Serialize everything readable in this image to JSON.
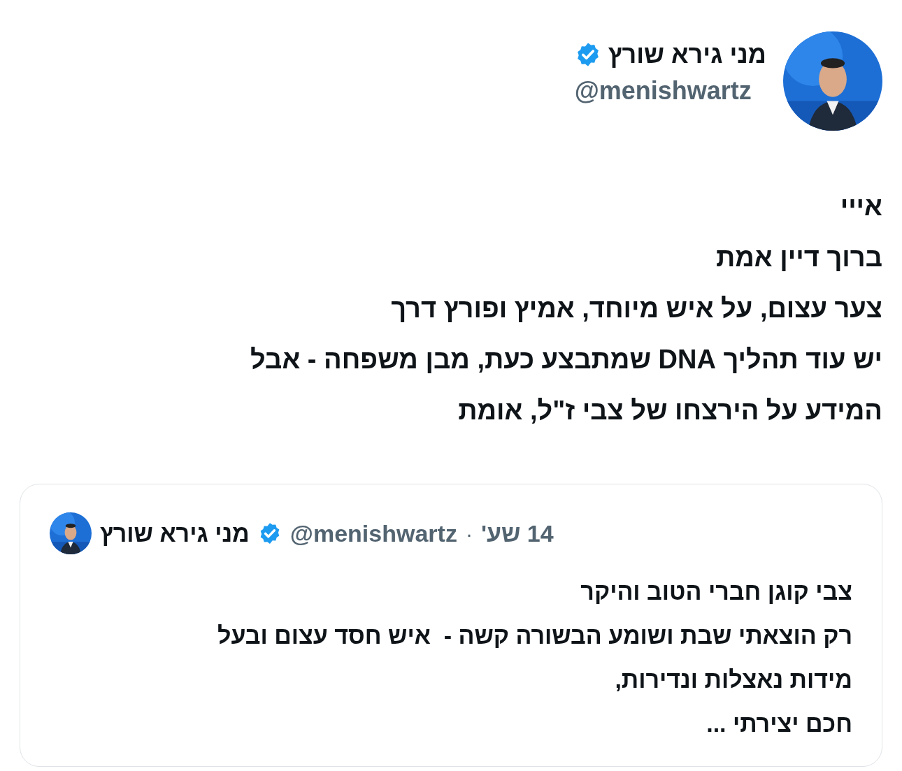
{
  "author": {
    "name": "מני גירא שורץ",
    "handle": "@menishwartz",
    "verified": true
  },
  "text_lines": [
    "אייי",
    "ברוך דיין אמת",
    "צער עצום, על איש מיוחד, אמיץ ופורץ דרך",
    "יש עוד תהליך DNA שמתבצע כעת, מבן משפחה - אבל",
    "המידע על הירצחו של צבי ז\"ל, אומת"
  ],
  "quoted_tweet": {
    "author": {
      "name": "מני גירא שורץ",
      "handle": "@menishwartz",
      "verified": true
    },
    "separator": "·",
    "time": "14 שע'",
    "text_lines": [
      "צבי קוגן חברי הטוב והיקר",
      "רק הוצאתי שבת ושומע הבשורה קשה -  איש חסד עצום ובעל",
      "מידות נאצלות ונדירות,",
      "חכם יצירתי ..."
    ]
  }
}
